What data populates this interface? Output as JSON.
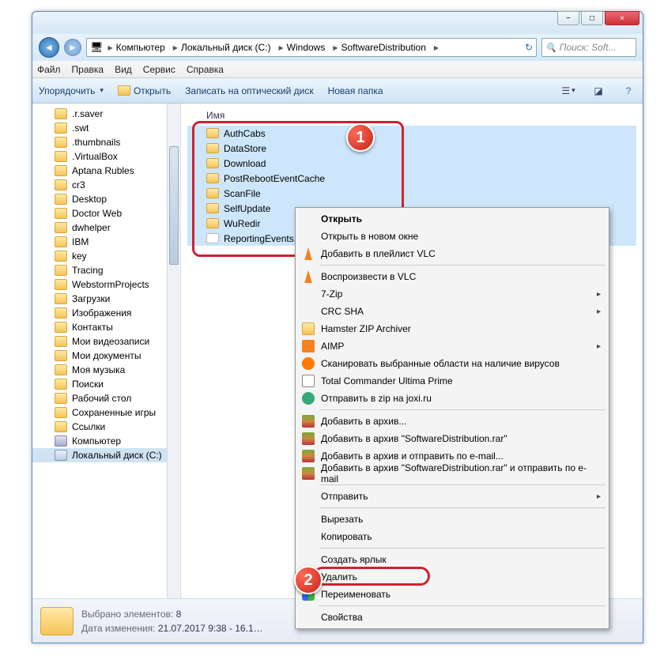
{
  "window": {
    "min": "−",
    "max": "□",
    "close": "×"
  },
  "breadcrumbs": [
    "Компьютер",
    "Локальный диск (C:)",
    "Windows",
    "SoftwareDistribution"
  ],
  "search_placeholder": "Поиск: Soft...",
  "menubar": [
    "Файл",
    "Правка",
    "Вид",
    "Сервис",
    "Справка"
  ],
  "toolbar": {
    "organize": "Упорядочить",
    "open": "Открыть",
    "burn": "Записать на оптический диск",
    "newfolder": "Новая папка"
  },
  "tree": [
    {
      "label": ".r.saver"
    },
    {
      "label": ".swt"
    },
    {
      "label": ".thumbnails"
    },
    {
      "label": ".VirtualBox"
    },
    {
      "label": "Aptana Rubles"
    },
    {
      "label": "cr3"
    },
    {
      "label": "Desktop"
    },
    {
      "label": "Doctor Web"
    },
    {
      "label": "dwhelper"
    },
    {
      "label": "IBM"
    },
    {
      "label": "key"
    },
    {
      "label": "Tracing"
    },
    {
      "label": "WebstormProjects"
    },
    {
      "label": "Загрузки"
    },
    {
      "label": "Изображения"
    },
    {
      "label": "Контакты"
    },
    {
      "label": "Мои видеозаписи"
    },
    {
      "label": "Мои документы"
    },
    {
      "label": "Моя музыка"
    },
    {
      "label": "Поиски"
    },
    {
      "label": "Рабочий стол"
    },
    {
      "label": "Сохраненные игры"
    },
    {
      "label": "Ссылки"
    },
    {
      "label": "Компьютер",
      "icon": "comp"
    },
    {
      "label": "Локальный диск (C:)",
      "icon": "drive",
      "sel": true
    }
  ],
  "column_header": "Имя",
  "files": [
    {
      "name": "AuthCabs",
      "type": "folder",
      "sel": true
    },
    {
      "name": "DataStore",
      "type": "folder",
      "sel": true
    },
    {
      "name": "Download",
      "type": "folder",
      "sel": true
    },
    {
      "name": "PostRebootEventCache",
      "type": "folder",
      "sel": true
    },
    {
      "name": "ScanFile",
      "type": "folder",
      "sel": true
    },
    {
      "name": "SelfUpdate",
      "type": "folder",
      "sel": true
    },
    {
      "name": "WuRedir",
      "type": "folder",
      "sel": true
    },
    {
      "name": "ReportingEvents.log",
      "type": "file",
      "sel": true
    }
  ],
  "context_menu": [
    {
      "label": "Открыть",
      "bold": true
    },
    {
      "label": "Открыть в новом окне"
    },
    {
      "label": "Добавить в плейлист VLC",
      "icon": "vlc"
    },
    {
      "sep": true
    },
    {
      "label": "Воспроизвести в VLC",
      "icon": "vlc"
    },
    {
      "label": "7-Zip",
      "sub": true
    },
    {
      "label": "CRC SHA",
      "sub": true
    },
    {
      "label": "Hamster ZIP Archiver",
      "icon": "zip"
    },
    {
      "label": "AIMP",
      "icon": "aimp",
      "sub": true
    },
    {
      "label": "Сканировать выбранные области на наличие вирусов",
      "icon": "avast"
    },
    {
      "label": "Total Commander Ultima Prime",
      "icon": "tc"
    },
    {
      "label": "Отправить в zip на joxi.ru",
      "icon": "joxi"
    },
    {
      "sep": true
    },
    {
      "label": "Добавить в архив...",
      "icon": "rar"
    },
    {
      "label": "Добавить в архив \"SoftwareDistribution.rar\"",
      "icon": "rar"
    },
    {
      "label": "Добавить в архив и отправить по e-mail...",
      "icon": "rar"
    },
    {
      "label": "Добавить в архив \"SoftwareDistribution.rar\" и отправить по e-mail",
      "icon": "rar"
    },
    {
      "sep": true
    },
    {
      "label": "Отправить",
      "sub": true
    },
    {
      "sep": true
    },
    {
      "label": "Вырезать"
    },
    {
      "label": "Копировать"
    },
    {
      "sep": true
    },
    {
      "label": "Создать ярлык"
    },
    {
      "label": "Удалить",
      "icon": "shield",
      "hl": true
    },
    {
      "label": "Переименовать",
      "icon": "shield"
    },
    {
      "sep": true
    },
    {
      "label": "Свойства"
    }
  ],
  "callouts": {
    "one": "1",
    "two": "2"
  },
  "status": {
    "line1_label": "Выбрано элементов:",
    "line1_value": "8",
    "line2_label": "Дата изменения:",
    "line2_value": "21.07.2017 9:38 - 16.1…"
  }
}
